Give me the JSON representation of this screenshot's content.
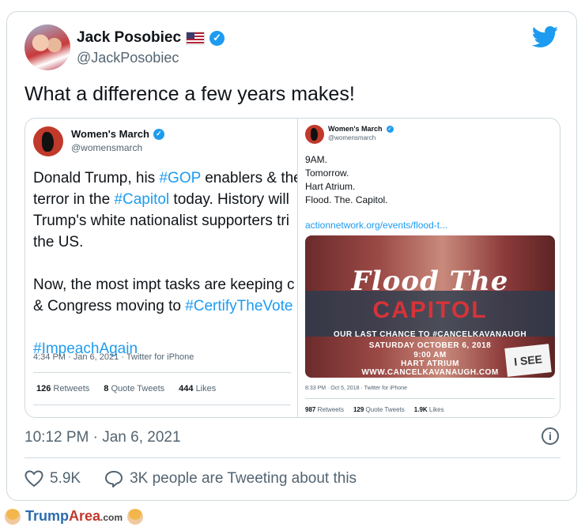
{
  "tweet": {
    "author_name": "Jack Posobiec",
    "author_handle": "@JackPosobiec",
    "text": "What a difference a few years makes!",
    "timestamp": "10:12 PM · Jan 6, 2021",
    "likes": "5.9K",
    "discussion": "3K people are Tweeting about this",
    "icons": {
      "flag": "us-flag-icon",
      "verified": "verified-badge-icon",
      "brand": "twitter-bird-icon",
      "info": "info-icon",
      "like": "heart-icon",
      "reply": "speech-bubble-icon"
    },
    "colors": {
      "accent": "#1d9bf0",
      "muted": "#536471",
      "text": "#0f1419"
    }
  },
  "quoted_left": {
    "name": "Women's March",
    "handle": "@womensmarch",
    "lines": [
      {
        "parts": [
          {
            "t": "Donald Trump, his "
          },
          {
            "t": "#GOP",
            "link": true
          },
          {
            "t": " enablers & the"
          }
        ]
      },
      {
        "parts": [
          {
            "t": "terror in the "
          },
          {
            "t": "#Capitol",
            "link": true
          },
          {
            "t": " today. History will"
          }
        ]
      },
      {
        "parts": [
          {
            "t": "Trump's white nationalist supporters tri"
          }
        ]
      },
      {
        "parts": [
          {
            "t": "the US."
          }
        ]
      },
      {
        "parts": [
          {
            "t": ""
          }
        ]
      },
      {
        "parts": [
          {
            "t": "Now, the most impt tasks are keeping c"
          }
        ]
      },
      {
        "parts": [
          {
            "t": "& Congress moving to "
          },
          {
            "t": "#CertifyTheVote",
            "link": true
          }
        ]
      },
      {
        "parts": [
          {
            "t": ""
          }
        ]
      },
      {
        "parts": [
          {
            "t": "#ImpeachAgain",
            "link": true
          }
        ]
      }
    ],
    "meta": "4:34 PM · Jan 6, 2021 · Twitter for iPhone",
    "retweets": "126",
    "retweets_label": "Retweets",
    "quotes": "8",
    "quotes_label": "Quote Tweets",
    "likes": "444",
    "likes_label": "Likes"
  },
  "quoted_right": {
    "name": "Women's March",
    "handle": "@womensmarch",
    "body": "9AM.\nTomorrow.\nHart Atrium.\nFlood. The. Capitol.",
    "link": "actionnetwork.org/events/flood-t...",
    "poster": {
      "headline": "Flood The",
      "headline2": "CAPITOL",
      "line1": "OUR LAST CHANCE TO #CANCELKAVANAUGH",
      "line2": "SATURDAY OCTOBER 6, 2018",
      "line3": "9:00 AM",
      "line4": "HART ATRIUM",
      "line5": "WWW.CANCELKAVANAUGH.COM",
      "sign": "I SEE"
    },
    "meta": "8:33 PM · Oct 5, 2018 · Twitter for iPhone",
    "retweets": "987",
    "retweets_label": "Retweets",
    "quotes": "129",
    "quotes_label": "Quote Tweets",
    "likes": "1.9K",
    "likes_label": "Likes"
  },
  "watermark": {
    "trump": "Trump",
    "area": "Area",
    "com": ".com"
  }
}
